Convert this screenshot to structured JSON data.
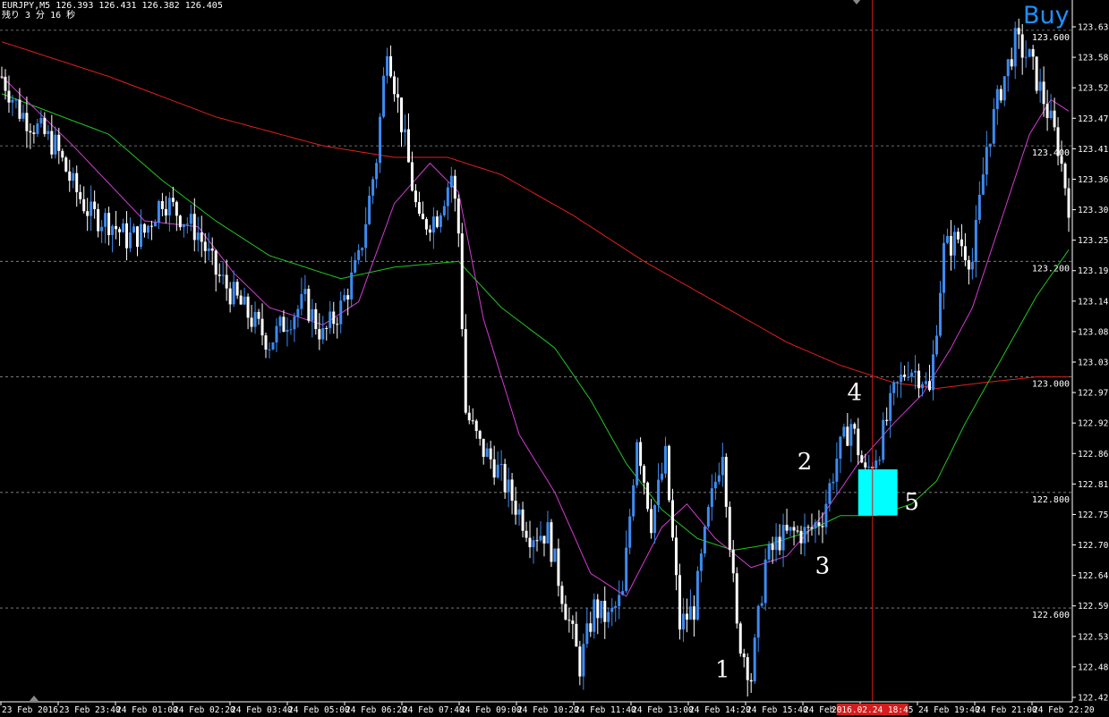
{
  "header": {
    "symbol_line": "EURJPY,M5  126.393 126.431 126.382 126.405",
    "timer_line": "残り 3 分 16 秒",
    "signal": "Buy"
  },
  "colors": {
    "background": "#000000",
    "bull": "#3d8bf0",
    "bear": "#ffffff",
    "fast_ma": "#d23cd2",
    "mid_ma": "#22c522",
    "slow_ma": "#e0201a",
    "cursor": "#d41d1d",
    "zone": "#00ffff",
    "grid": "#8c8c8c",
    "signal": "#1e90ff"
  },
  "chart_data": {
    "type": "candlestick",
    "symbol": "EURJPY",
    "timeframe": "M5",
    "ylim": [
      122.45,
      123.64
    ],
    "yticks": [
      "123.635",
      "123.580",
      "123.525",
      "123.470",
      "123.415",
      "123.360",
      "123.305",
      "123.250",
      "123.195",
      "123.140",
      "123.085",
      "123.030",
      "122.975",
      "122.920",
      "122.865",
      "122.810",
      "122.755",
      "122.700",
      "122.645",
      "122.590",
      "122.535",
      "122.480",
      "122.425"
    ],
    "grid_levels": [
      123.6,
      123.4,
      123.2,
      123.0,
      122.8,
      122.6
    ],
    "level_labels": [
      "123.600",
      "123.400",
      "123.200",
      "123.000",
      "122.800",
      "122.600"
    ],
    "xticks": [
      "23 Feb 2016",
      "23 Feb 23:40",
      "24 Feb 01:00",
      "24 Feb 02:20",
      "24 Feb 03:40",
      "24 Feb 05:00",
      "24 Feb 06:20",
      "24 Feb 07:40",
      "24 Feb 09:00",
      "24 Feb 10:20",
      "24 Feb 11:40",
      "24 Feb 13:00",
      "24 Feb 14:20",
      "24 Feb 15:40",
      "24 Feb 17:",
      " ",
      "24 Feb 19:40",
      "24 Feb 21:00",
      "24 Feb 22:20"
    ],
    "cursor_label": "2016.02.24 18:45",
    "cursor_index": 244,
    "price_path": [
      [
        0,
        123.52
      ],
      [
        5,
        123.46
      ],
      [
        10,
        123.43
      ],
      [
        15,
        123.4
      ],
      [
        20,
        123.33
      ],
      [
        25,
        123.28
      ],
      [
        30,
        123.27
      ],
      [
        35,
        123.24
      ],
      [
        40,
        123.25
      ],
      [
        45,
        123.31
      ],
      [
        50,
        123.28
      ],
      [
        55,
        123.25
      ],
      [
        60,
        123.18
      ],
      [
        65,
        123.14
      ],
      [
        70,
        123.1
      ],
      [
        75,
        123.06
      ],
      [
        80,
        123.1
      ],
      [
        85,
        123.13
      ],
      [
        90,
        123.07
      ],
      [
        95,
        123.12
      ],
      [
        100,
        123.2
      ],
      [
        105,
        123.38
      ],
      [
        108,
        123.58
      ],
      [
        112,
        123.44
      ],
      [
        117,
        123.26
      ],
      [
        122,
        123.28
      ],
      [
        126,
        123.35
      ],
      [
        128,
        123.25
      ],
      [
        130,
        122.94
      ],
      [
        134,
        122.88
      ],
      [
        138,
        122.85
      ],
      [
        143,
        122.79
      ],
      [
        148,
        122.73
      ],
      [
        153,
        122.73
      ],
      [
        158,
        122.6
      ],
      [
        162,
        122.5
      ],
      [
        166,
        122.6
      ],
      [
        170,
        122.58
      ],
      [
        174,
        122.62
      ],
      [
        178,
        122.9
      ],
      [
        182,
        122.75
      ],
      [
        186,
        122.86
      ],
      [
        190,
        122.57
      ],
      [
        194,
        122.6
      ],
      [
        198,
        122.76
      ],
      [
        202,
        122.88
      ],
      [
        206,
        122.56
      ],
      [
        210,
        122.48
      ],
      [
        214,
        122.68
      ],
      [
        218,
        122.72
      ],
      [
        222,
        122.73
      ],
      [
        226,
        122.73
      ],
      [
        230,
        122.76
      ],
      [
        234,
        122.86
      ],
      [
        238,
        122.92
      ],
      [
        242,
        122.83
      ],
      [
        246,
        122.88
      ],
      [
        250,
        122.97
      ],
      [
        254,
        123.02
      ],
      [
        258,
        123.0
      ],
      [
        260,
        122.97
      ],
      [
        264,
        123.22
      ],
      [
        268,
        123.24
      ],
      [
        272,
        123.2
      ],
      [
        276,
        123.4
      ],
      [
        280,
        123.5
      ],
      [
        284,
        123.58
      ],
      [
        288,
        123.55
      ],
      [
        292,
        123.48
      ],
      [
        296,
        123.4
      ],
      [
        299,
        123.3
      ]
    ],
    "ma_fast": [
      [
        0,
        123.52
      ],
      [
        20,
        123.4
      ],
      [
        40,
        123.27
      ],
      [
        55,
        123.26
      ],
      [
        65,
        123.18
      ],
      [
        75,
        123.12
      ],
      [
        90,
        123.09
      ],
      [
        100,
        123.13
      ],
      [
        110,
        123.3
      ],
      [
        120,
        123.37
      ],
      [
        128,
        123.32
      ],
      [
        135,
        123.1
      ],
      [
        145,
        122.9
      ],
      [
        155,
        122.8
      ],
      [
        165,
        122.66
      ],
      [
        175,
        122.62
      ],
      [
        185,
        122.74
      ],
      [
        192,
        122.78
      ],
      [
        200,
        122.72
      ],
      [
        210,
        122.67
      ],
      [
        220,
        122.69
      ],
      [
        230,
        122.76
      ],
      [
        240,
        122.85
      ],
      [
        250,
        122.92
      ],
      [
        258,
        122.97
      ],
      [
        266,
        123.05
      ],
      [
        272,
        123.12
      ],
      [
        280,
        123.27
      ],
      [
        288,
        123.42
      ],
      [
        294,
        123.48
      ],
      [
        299,
        123.46
      ]
    ],
    "ma_mid": [
      [
        0,
        123.49
      ],
      [
        30,
        123.42
      ],
      [
        45,
        123.34
      ],
      [
        60,
        123.27
      ],
      [
        75,
        123.21
      ],
      [
        95,
        123.17
      ],
      [
        110,
        123.19
      ],
      [
        128,
        123.2
      ],
      [
        140,
        123.12
      ],
      [
        155,
        123.05
      ],
      [
        165,
        122.96
      ],
      [
        175,
        122.85
      ],
      [
        185,
        122.77
      ],
      [
        195,
        122.72
      ],
      [
        205,
        122.7
      ],
      [
        215,
        122.71
      ],
      [
        225,
        122.73
      ],
      [
        235,
        122.76
      ],
      [
        245,
        122.76
      ],
      [
        255,
        122.78
      ],
      [
        262,
        122.82
      ],
      [
        270,
        122.92
      ],
      [
        280,
        123.03
      ],
      [
        290,
        123.14
      ],
      [
        299,
        123.22
      ]
    ],
    "ma_slow": [
      [
        0,
        123.58
      ],
      [
        30,
        123.52
      ],
      [
        60,
        123.45
      ],
      [
        90,
        123.4
      ],
      [
        110,
        123.38
      ],
      [
        125,
        123.38
      ],
      [
        140,
        123.35
      ],
      [
        160,
        123.28
      ],
      [
        180,
        123.2
      ],
      [
        200,
        123.13
      ],
      [
        220,
        123.06
      ],
      [
        235,
        123.02
      ],
      [
        250,
        122.99
      ],
      [
        262,
        122.98
      ],
      [
        275,
        122.99
      ],
      [
        290,
        123.0
      ],
      [
        299,
        123.0
      ]
    ],
    "zone": {
      "i0": 240,
      "i1": 251,
      "top": 122.84,
      "bottom": 122.76
    },
    "annotations": [
      {
        "text": "1",
        "i": 202,
        "y": 122.48
      },
      {
        "text": "2",
        "i": 225,
        "y": 122.84
      },
      {
        "text": "3",
        "i": 230,
        "y": 122.66
      },
      {
        "text": "4",
        "i": 239,
        "y": 122.96
      },
      {
        "text": "5",
        "i": 255,
        "y": 122.77
      }
    ]
  }
}
